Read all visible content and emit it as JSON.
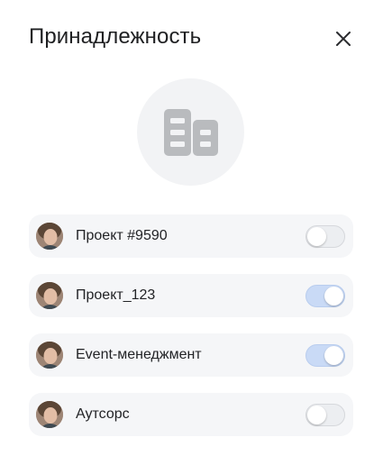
{
  "dialog": {
    "title": "Принадлежность",
    "close_icon": "close-icon",
    "hero_icon": "building-icon"
  },
  "items": [
    {
      "label": "Проект #9590",
      "enabled": false
    },
    {
      "label": "Проект_123",
      "enabled": true
    },
    {
      "label": "Event-менеджмент",
      "enabled": true
    },
    {
      "label": "Аутсорс",
      "enabled": false
    }
  ],
  "colors": {
    "toggle_on": "#c9daf6",
    "toggle_off": "#eceef1",
    "row_bg": "#f5f6f8",
    "icon_gray": "#b9bbbe"
  }
}
